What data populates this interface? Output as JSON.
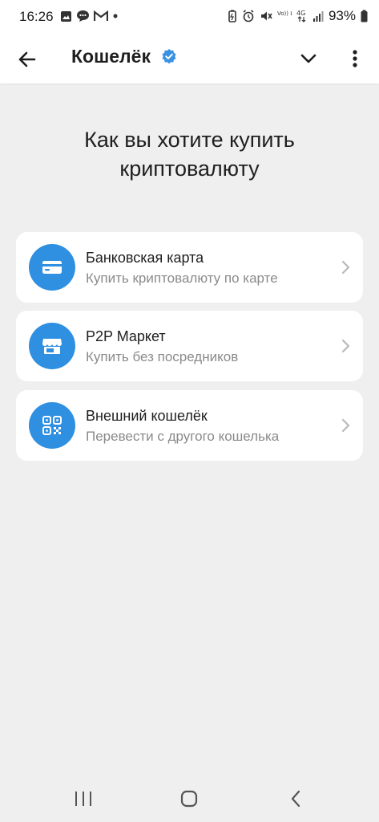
{
  "status_bar": {
    "time": "16:26",
    "battery": "93%",
    "left_icons": [
      "gallery-icon",
      "chat-icon",
      "gmail-icon",
      "dot-icon"
    ],
    "right_icons": [
      "battery-saver-icon",
      "alarm-icon",
      "mute-icon",
      "volte-icon",
      "4g-icon",
      "signal-icon",
      "battery-icon"
    ],
    "network_label": "Vo)) LTE",
    "network_type": "4G"
  },
  "header": {
    "title": "Кошелёк",
    "verified": true
  },
  "page": {
    "heading": "Как вы хотите купить криптовалюту"
  },
  "options": [
    {
      "title": "Банковская карта",
      "subtitle": "Купить криптовалюту по карте",
      "icon": "credit-card-icon"
    },
    {
      "title": "P2P Маркет",
      "subtitle": "Купить без посредников",
      "icon": "store-icon"
    },
    {
      "title": "Внешний кошелёк",
      "subtitle": "Перевести с другого кошелька",
      "icon": "qr-code-icon"
    }
  ],
  "theme": {
    "accent": "#2f8fe0",
    "background": "#efefef",
    "card": "#ffffff",
    "subtitle_color": "#8a8a8a"
  }
}
